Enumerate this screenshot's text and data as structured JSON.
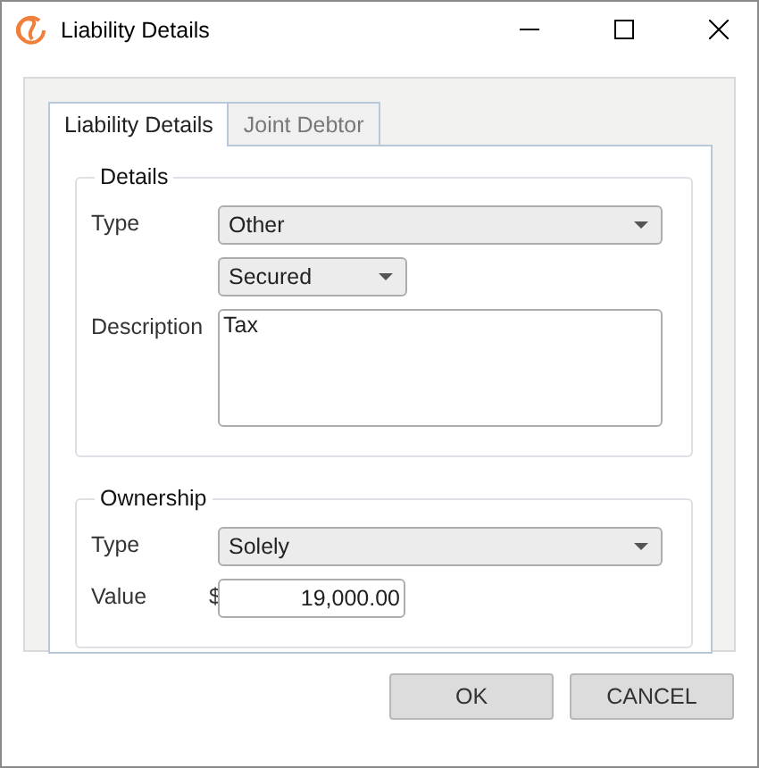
{
  "window": {
    "title": "Liability Details"
  },
  "tabs": [
    {
      "label": "Liability Details",
      "selected": true
    },
    {
      "label": "Joint Debtor",
      "selected": false
    }
  ],
  "groups": [
    {
      "legend": "Details",
      "rows": [
        {
          "kind": "combo",
          "label": "Type",
          "value": "Other"
        },
        {
          "kind": "short-combo",
          "value": "Secured"
        },
        {
          "kind": "textarea",
          "label": "Description",
          "value": "Tax"
        }
      ]
    },
    {
      "legend": "Ownership",
      "rows": [
        {
          "kind": "combo",
          "label": "Type",
          "value": "Solely"
        },
        {
          "kind": "money",
          "label": "Value",
          "currency": "$",
          "value": "19,000.00"
        }
      ]
    }
  ],
  "buttons": [
    {
      "label": "OK"
    },
    {
      "label": "CANCEL"
    }
  ]
}
